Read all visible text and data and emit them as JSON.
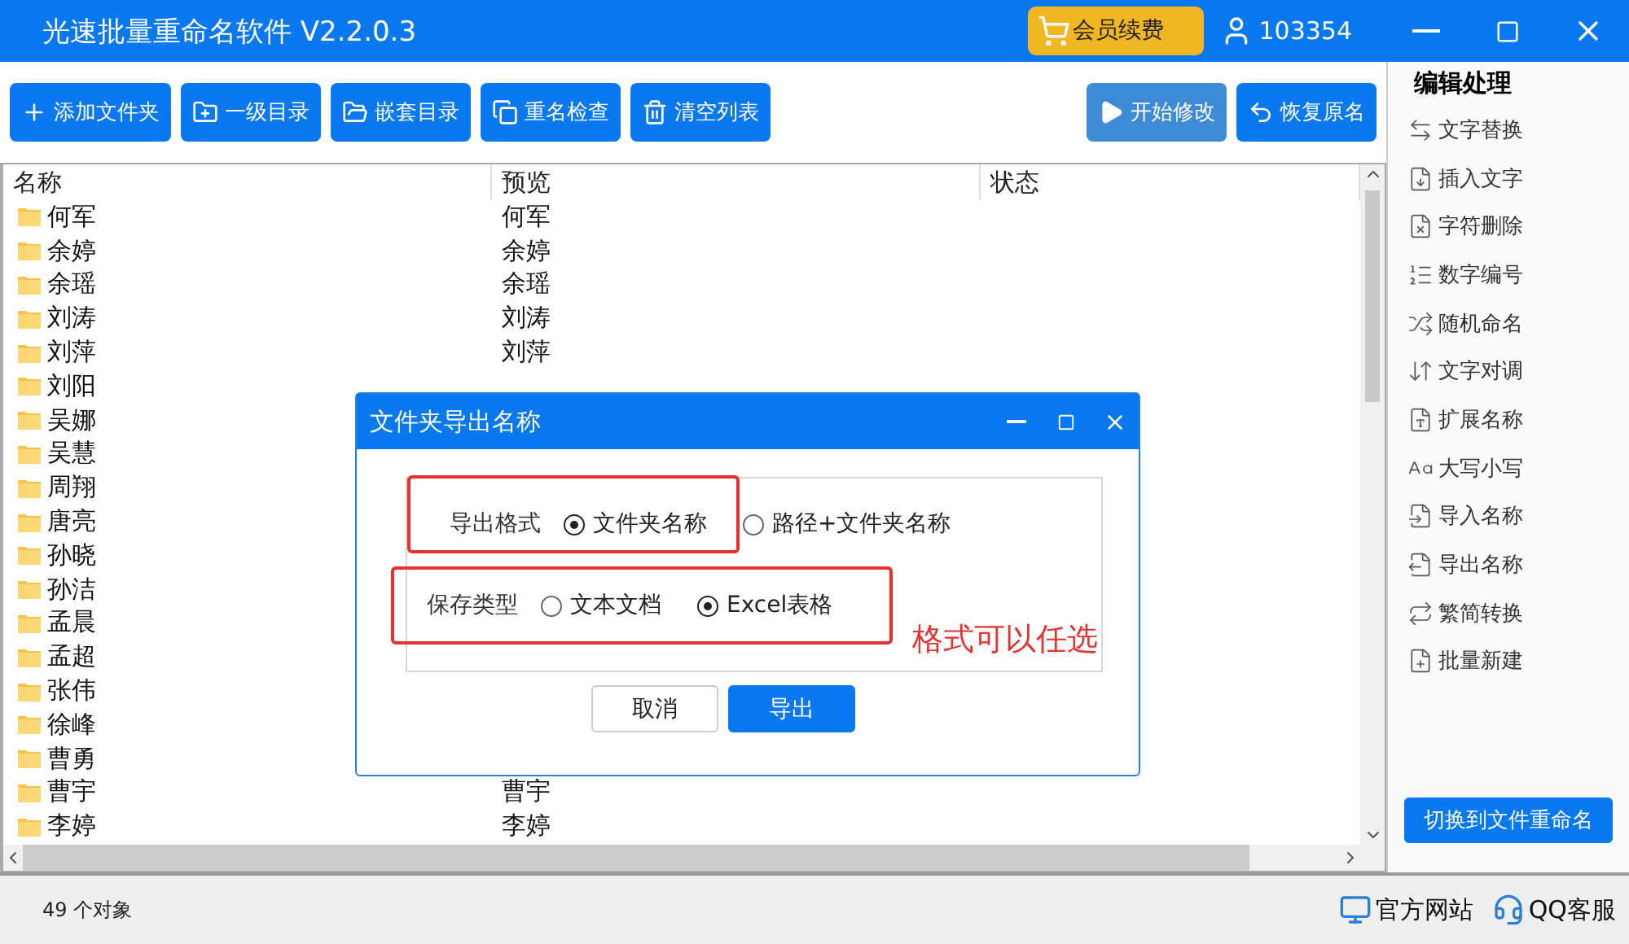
{
  "window": {
    "title": "光速批量重命名软件 V2.2.0.3",
    "vip_button": "会员续费",
    "user_id": "103354"
  },
  "toolbar": {
    "left": [
      {
        "label": "添加文件夹",
        "disabled": false
      },
      {
        "label": "一级目录",
        "disabled": false
      },
      {
        "label": "嵌套目录",
        "disabled": false
      },
      {
        "label": "重名检查",
        "disabled": false
      },
      {
        "label": "清空列表",
        "disabled": false
      }
    ],
    "right": [
      {
        "label": "开始修改",
        "disabled": true
      },
      {
        "label": "恢复原名",
        "disabled": false
      }
    ]
  },
  "table": {
    "columns": [
      "名称",
      "预览",
      "状态"
    ],
    "rows": [
      {
        "name": "何军",
        "preview": "何军"
      },
      {
        "name": "余婷",
        "preview": "余婷"
      },
      {
        "name": "余瑶",
        "preview": "余瑶"
      },
      {
        "name": "刘涛",
        "preview": "刘涛"
      },
      {
        "name": "刘萍",
        "preview": "刘萍"
      },
      {
        "name": "刘阳"
      },
      {
        "name": "吴娜"
      },
      {
        "name": "吴慧"
      },
      {
        "name": "周翔"
      },
      {
        "name": "唐亮"
      },
      {
        "name": "孙晓"
      },
      {
        "name": "孙洁"
      },
      {
        "name": "孟晨"
      },
      {
        "name": "孟超"
      },
      {
        "name": "张伟"
      },
      {
        "name": "徐峰"
      },
      {
        "name": "曹勇"
      },
      {
        "name": "曹宇",
        "preview": "曹宇"
      },
      {
        "name": "李婷",
        "preview": "李婷"
      }
    ]
  },
  "sidebar": {
    "title": "编辑处理",
    "items": [
      "文字替换",
      "插入文字",
      "字符删除",
      "数字编号",
      "随机命名",
      "文字对调",
      "扩展名称",
      "大写小写",
      "导入名称",
      "导出名称",
      "繁简转换",
      "批量新建"
    ],
    "switch_button": "切换到文件重命名"
  },
  "status_bar": {
    "count": "49 个对象",
    "website": "官方网站",
    "support": "QQ客服"
  },
  "dialog": {
    "title": "文件夹导出名称",
    "groups": [
      {
        "label": "导出格式",
        "options": [
          {
            "label": "文件夹名称",
            "selected": true
          },
          {
            "label": "路径+文件夹名称",
            "selected": false
          }
        ]
      },
      {
        "label": "保存类型",
        "options": [
          {
            "label": "文本文档",
            "selected": false
          },
          {
            "label": "Excel表格",
            "selected": true
          }
        ]
      }
    ],
    "annotation": "格式可以任选",
    "buttons": [
      {
        "label": "取消",
        "primary": false
      },
      {
        "label": "导出",
        "primary": true
      }
    ]
  }
}
